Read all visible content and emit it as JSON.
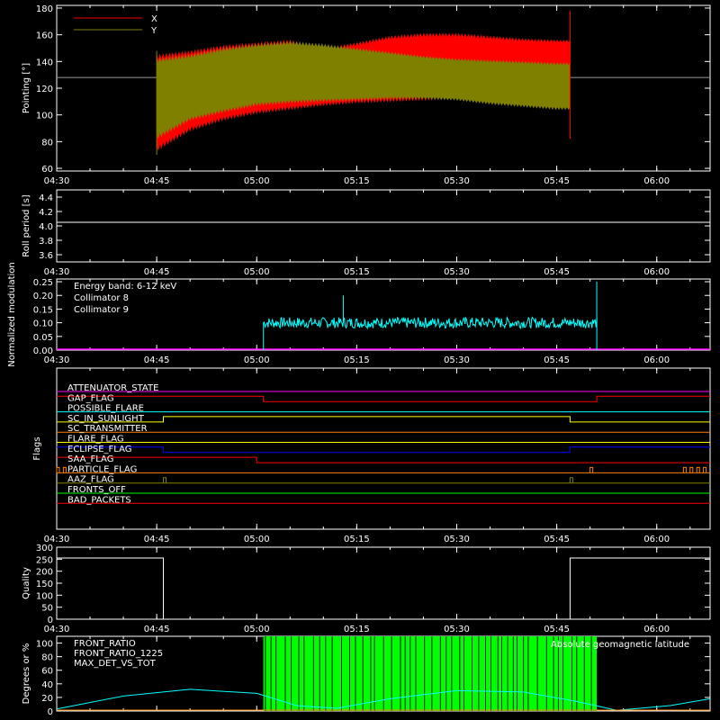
{
  "time_axis": {
    "ticks": [
      "04:30",
      "04:45",
      "05:00",
      "05:15",
      "05:30",
      "05:45",
      "06:00"
    ],
    "start": "04:30",
    "end": "06:08"
  },
  "chart_data": [
    {
      "type": "line",
      "ylabel": "Pointing [°]",
      "ylim": [
        58,
        182
      ],
      "yticks": [
        60,
        80,
        100,
        120,
        140,
        160,
        180
      ],
      "reference_line": 128,
      "legend": [
        {
          "name": "X",
          "color": "#ff0000"
        },
        {
          "name": "Y",
          "color": "#808000"
        }
      ],
      "x_range": [
        "04:45",
        "05:47"
      ],
      "envelope": [
        {
          "t": "04:45",
          "x_lo": 73,
          "x_hi": 145,
          "y_lo": 82,
          "y_hi": 142
        },
        {
          "t": "04:50",
          "x_lo": 88,
          "x_hi": 148,
          "y_lo": 96,
          "y_hi": 145
        },
        {
          "t": "04:55",
          "x_lo": 96,
          "x_hi": 152,
          "y_lo": 102,
          "y_hi": 150
        },
        {
          "t": "05:00",
          "x_lo": 101,
          "x_hi": 154,
          "y_lo": 107,
          "y_hi": 153
        },
        {
          "t": "05:05",
          "x_lo": 104,
          "x_hi": 156,
          "y_lo": 109,
          "y_hi": 155
        },
        {
          "t": "05:10",
          "x_lo": 107,
          "x_hi": 150,
          "y_lo": 110,
          "y_hi": 153
        },
        {
          "t": "05:15",
          "x_lo": 109,
          "x_hi": 154,
          "y_lo": 111,
          "y_hi": 150
        },
        {
          "t": "05:20",
          "x_lo": 110,
          "x_hi": 159,
          "y_lo": 112,
          "y_hi": 147
        },
        {
          "t": "05:25",
          "x_lo": 111,
          "x_hi": 161,
          "y_lo": 112,
          "y_hi": 144
        },
        {
          "t": "05:30",
          "x_lo": 112,
          "x_hi": 161,
          "y_lo": 111,
          "y_hi": 142
        },
        {
          "t": "05:35",
          "x_lo": 115,
          "x_hi": 159,
          "y_lo": 108,
          "y_hi": 141
        },
        {
          "t": "05:40",
          "x_lo": 119,
          "x_hi": 157,
          "y_lo": 106,
          "y_hi": 140
        },
        {
          "t": "05:45",
          "x_lo": 121,
          "x_hi": 156,
          "y_lo": 104,
          "y_hi": 139
        }
      ]
    },
    {
      "type": "line",
      "ylabel": "Roll period [s]",
      "ylim": [
        3.5,
        4.5
      ],
      "yticks": [
        3.6,
        3.8,
        4.0,
        4.2,
        4.4
      ],
      "series": [
        {
          "value": 4.05,
          "color": "#ffffff"
        }
      ]
    },
    {
      "type": "line",
      "ylabel": "Normalized modulation",
      "ylim": [
        0,
        0.26
      ],
      "yticks": [
        0.0,
        0.05,
        0.1,
        0.15,
        0.2,
        0.25
      ],
      "annotation": "Energy band: 6-12 keV",
      "legend": [
        {
          "name": "Collimator 8",
          "color": "#00ffff"
        },
        {
          "name": "Collimator 9",
          "color": "#ff00ff"
        }
      ],
      "collimator8": {
        "start": "05:01",
        "end": "05:51",
        "mean": 0.1,
        "noise": 0.02,
        "spikes": [
          {
            "t": "05:13",
            "v": 0.2
          },
          {
            "t": "05:51",
            "v": 0.25
          }
        ]
      },
      "collimator9": {
        "value": 0.0
      }
    },
    {
      "type": "line",
      "ylabel": "Flags",
      "flags": [
        {
          "name": "ATTENUATOR_STATE",
          "color": "#ff00ff",
          "steps": [
            [
              "04:30",
              0
            ]
          ]
        },
        {
          "name": "GAP_FLAG",
          "color": "#ff0000",
          "steps": [
            [
              "04:30",
              1
            ],
            [
              "05:01",
              0
            ],
            [
              "05:51",
              1
            ]
          ]
        },
        {
          "name": "POSSIBLE_FLARE",
          "color": "#00ffff",
          "steps": [
            [
              "04:30",
              0
            ]
          ]
        },
        {
          "name": "SC_IN_SUNLIGHT",
          "color": "#ffff00",
          "steps": [
            [
              "04:30",
              0
            ],
            [
              "04:46",
              1
            ],
            [
              "05:47",
              0
            ]
          ]
        },
        {
          "name": "SC_TRANSMITTER",
          "color": "#ff8000",
          "steps": [
            [
              "04:30",
              0
            ]
          ]
        },
        {
          "name": "FLARE_FLAG",
          "color": "#ffff00",
          "steps": [
            [
              "04:30",
              0
            ]
          ]
        },
        {
          "name": "ECLIPSE_FLAG",
          "color": "#0000ff",
          "steps": [
            [
              "04:30",
              1
            ],
            [
              "04:46",
              0
            ],
            [
              "05:47",
              1
            ]
          ]
        },
        {
          "name": "SAA_FLAG",
          "color": "#ff0000",
          "steps": [
            [
              "04:30",
              1
            ],
            [
              "05:00",
              0
            ]
          ]
        },
        {
          "name": "PARTICLE_FLAG",
          "color": "#ff8000",
          "steps": [
            [
              "04:30",
              0
            ]
          ],
          "pulses": [
            "04:30",
            "04:31",
            "05:50",
            "06:04",
            "06:05",
            "06:06",
            "06:07"
          ]
        },
        {
          "name": "AAZ_FLAG",
          "color": "#808000",
          "steps": [
            [
              "04:30",
              0
            ]
          ],
          "pulses": [
            "04:46",
            "05:47"
          ]
        },
        {
          "name": "FRONTS_OFF",
          "color": "#00ff00",
          "steps": [
            [
              "04:30",
              0
            ]
          ]
        },
        {
          "name": "BAD_PACKETS",
          "color": "#ff0000",
          "steps": [
            [
              "04:30",
              0
            ]
          ]
        }
      ]
    },
    {
      "type": "line",
      "ylabel": "Quality",
      "ylim": [
        0,
        300
      ],
      "yticks": [
        0,
        50,
        100,
        150,
        200,
        250,
        300
      ],
      "series": [
        {
          "steps": [
            [
              "04:30",
              255
            ],
            [
              "04:46",
              0
            ],
            [
              "05:47",
              255
            ]
          ],
          "color": "#ffffff"
        }
      ]
    },
    {
      "type": "line",
      "ylabel": "Degrees or %",
      "ylim": [
        0,
        110
      ],
      "yticks": [
        0,
        20,
        40,
        60,
        80,
        100
      ],
      "legend": [
        {
          "name": "FRONT_RATIO",
          "color": "#ffff00"
        },
        {
          "name": "FRONT_RATIO_1225",
          "color": "#00ff00"
        },
        {
          "name": "MAX_DET_VS_TOT",
          "color": "#ff8000"
        }
      ],
      "right_label": {
        "name": "Absolute geomagnetic latitude",
        "color": "#00ffff"
      },
      "front_ratio_1225": {
        "start": "05:01",
        "end": "05:51",
        "value": 110
      },
      "latitude": [
        {
          "t": "04:30",
          "v": 3
        },
        {
          "t": "04:40",
          "v": 22
        },
        {
          "t": "04:50",
          "v": 32
        },
        {
          "t": "05:00",
          "v": 26
        },
        {
          "t": "05:06",
          "v": 8
        },
        {
          "t": "05:12",
          "v": 4
        },
        {
          "t": "05:20",
          "v": 18
        },
        {
          "t": "05:30",
          "v": 30
        },
        {
          "t": "05:40",
          "v": 28
        },
        {
          "t": "05:48",
          "v": 14
        },
        {
          "t": "05:54",
          "v": 1
        },
        {
          "t": "06:02",
          "v": 8
        },
        {
          "t": "06:08",
          "v": 18
        }
      ]
    }
  ]
}
